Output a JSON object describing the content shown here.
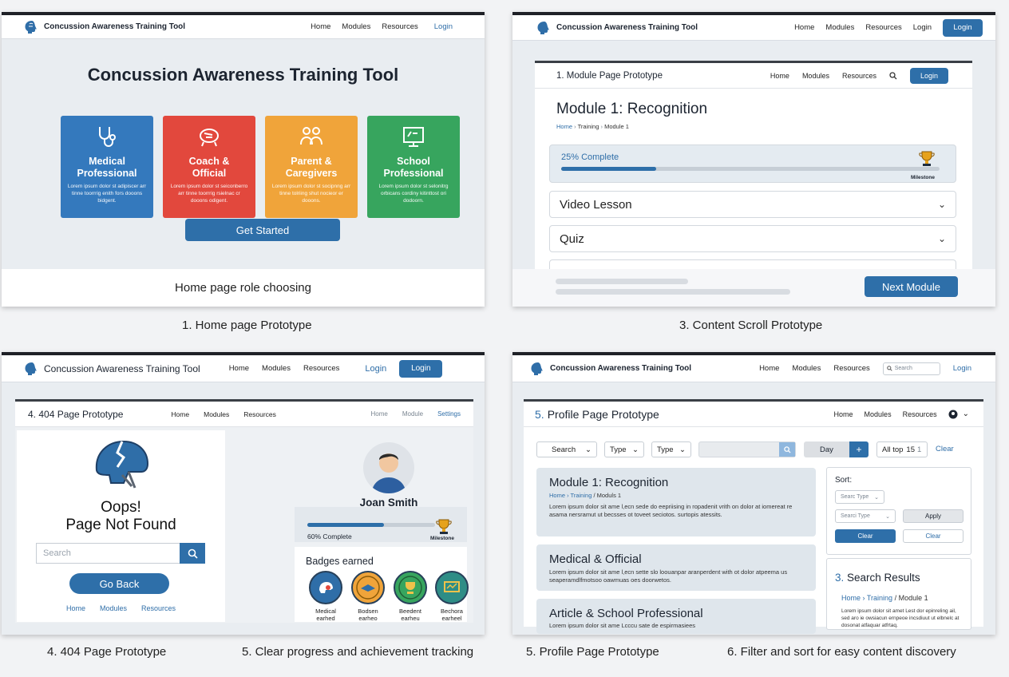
{
  "panel1": {
    "brand": "Concussion Awareness Training Tool",
    "nav": [
      "Home",
      "Modules",
      "Resources",
      "Login"
    ],
    "hero_title": "Concussion Awareness Training Tool",
    "cards": [
      {
        "title": "Medical\nProfessional",
        "desc": "Lorem ipsum dolor st adipiscer arr tinne toorrrig enith fors dooons bidgent.",
        "color": "#3479bd"
      },
      {
        "title": "Coach &\nOfficial",
        "desc": "Lorem ipsum dolor st seiconberro arr tinne toorrrig rsielnac cr dooons odigent.",
        "color": "#e2483d"
      },
      {
        "title": "Parent &\nCaregivers",
        "desc": "Lorem ipsum dolor st socipnng arr tinne tolriing shut nocieor er dooons.",
        "color": "#f0a43a"
      },
      {
        "title": "School\nProfessional",
        "desc": "Lorem ipsum dolor st selonitrg orbicans cordiny kitinttost ori dodoorn.",
        "color": "#37a55e"
      }
    ],
    "cta": "Get Started",
    "footer_note": "Home page role choosing",
    "caption": "1. Home page Prototype"
  },
  "panel2": {
    "brand": "Concussion Awareness Training Tool",
    "nav": [
      "Home",
      "Modules",
      "Resources",
      "Login"
    ],
    "login_button": "Login",
    "inner_title": "1. Module Page Prototype",
    "inner_nav": [
      "Home",
      "Modules",
      "Resources"
    ],
    "inner_login": "Login",
    "module_title": "Module 1: Recognition",
    "breadcrumb": [
      "Home",
      "Training",
      "Module 1"
    ],
    "progress_label": "25% Complete",
    "progress": 0.25,
    "milestone": "Milestone",
    "sections": [
      "Video Lesson",
      "Quiz"
    ],
    "next_button": "Next Module",
    "caption": "3. Content Scroll Prototype"
  },
  "panel3": {
    "brand": "Concussion Awareness Training Tool",
    "nav": [
      "Home",
      "Modules",
      "Resources",
      "Login"
    ],
    "login_button": "Login",
    "inner_title": "4. 404 Page Prototype",
    "inner_nav": [
      "Home",
      "Modules",
      "Resources"
    ],
    "inner_nav_right": [
      "Home",
      "Module",
      "Settings"
    ],
    "oops": "Oops!",
    "not_found": "Page Not Found",
    "search_placeholder": "Search",
    "go_back": "Go Back",
    "footer_links": [
      "Home",
      "Modules",
      "Resources"
    ],
    "user_name": "Joan Smith",
    "progress_label": "60% Complete",
    "progress": 0.6,
    "milestone": "Milestone",
    "badges_title": "Badges earned",
    "badges": [
      {
        "label": "Medical\nearhed",
        "color": "#2f6ea8"
      },
      {
        "label": "Bodsen\nearheo",
        "color": "#f0a43a"
      },
      {
        "label": "Beedent\nearheu",
        "color": "#37a55e"
      },
      {
        "label": "Bechora\nearheel",
        "color": "#2e8d86"
      }
    ],
    "caption_left": "4. 404 Page Prototype",
    "caption_right": "5. Clear progress and achievement tracking"
  },
  "panel4": {
    "brand": "Concussion Awareness Training Tool",
    "nav": [
      "Home",
      "Modules",
      "Resources",
      "Login"
    ],
    "search_placeholder": "Search",
    "inner_title": "Profile Page Prototype",
    "inner_num": "5.",
    "inner_nav": [
      "Home",
      "Modules",
      "Resources"
    ],
    "filters": [
      "Search",
      "Type",
      "Type"
    ],
    "day_label": "Day",
    "all_top": "All top",
    "count": "15",
    "clear_link": "Clear",
    "results": [
      {
        "title": "Module 1: Recognition",
        "crumbs": [
          "Home",
          "Training",
          "Moduls 1"
        ],
        "body": "Lorem ipsum dolor sit ame l,ecn sede do eepriising in ropadenit vrith on dolor at iomereat re asama nersramut ut becsses ot toveet seciotos. surtopis atessits."
      },
      {
        "title": "Medical & Official",
        "crumbs": [],
        "body": "Lorem ipsum dolor sit ame l,ecn sette slo loouanpar aranperdent with ot dolor atpeema us seaperamdlfmotsoo oawmuas oes doorwetos."
      },
      {
        "title": "Article & School Professional",
        "crumbs": [],
        "body": "Lorem ipsum dolor sit ame Lcccu sate de espirmasiees"
      }
    ],
    "sort_label": "Sort:",
    "sort_type": "Searc Type",
    "search_type": "Searci Type",
    "apply": "Apply",
    "clear_primary": "Clear",
    "clear_secondary": "Clear",
    "results_num": "3.",
    "results_title": "Search Results",
    "results_crumbs": [
      "Home",
      "Training",
      "Module 1"
    ],
    "results_body": "Lorem ipsum dolor sit amet Lest dor epinreling ail, sed aro ie owsiacun ernpeoe incsdiuut ut elbnelc at dosonat atfaquar atfrtaq.",
    "caption_left": "5. Profile Page Prototype",
    "caption_right": "6. Filter and sort for easy content discovery"
  }
}
